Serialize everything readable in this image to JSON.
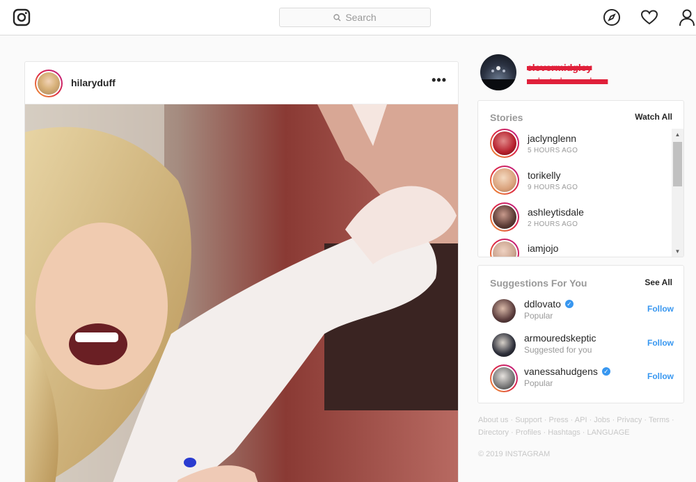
{
  "nav": {
    "search_placeholder": "Search"
  },
  "post": {
    "username": "hilaryduff",
    "more": "•••"
  },
  "me": {
    "name": "clevermidgley",
    "fullname": "redacted name here"
  },
  "stories": {
    "title": "Stories",
    "link": "Watch All",
    "items": [
      {
        "name": "jaclynglenn",
        "time": "5 HOURS AGO",
        "color": "#b51f2c"
      },
      {
        "name": "torikelly",
        "time": "9 HOURS AGO",
        "color": "#d9a17b"
      },
      {
        "name": "ashleytisdale",
        "time": "2 HOURS AGO",
        "color": "#5a3a34"
      },
      {
        "name": "iamjojo",
        "time": "",
        "color": "#c9a38e"
      }
    ]
  },
  "suggestions": {
    "title": "Suggestions For You",
    "link": "See All",
    "follow_label": "Follow",
    "items": [
      {
        "name": "ddlovato",
        "sub": "Popular",
        "verified": true,
        "color": "#5b3d3d"
      },
      {
        "name": "armouredskeptic",
        "sub": "Suggested for you",
        "verified": false,
        "color": "#2d2f3a"
      },
      {
        "name": "vanessahudgens",
        "sub": "Popular",
        "verified": true,
        "color": "#777"
      }
    ]
  },
  "footer": {
    "line1": "About us · Support · Press · API · Jobs · Privacy · Terms ·",
    "line2": "Directory · Profiles · Hashtags · LANGUAGE",
    "copyright": "© 2019 INSTAGRAM"
  },
  "colors": {
    "accent": "#3897f0",
    "border": "#dbdbdb"
  }
}
